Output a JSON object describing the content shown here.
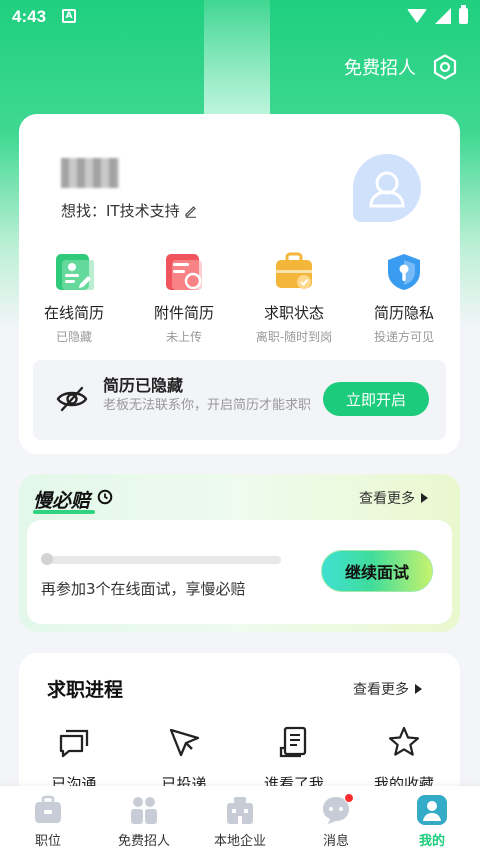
{
  "status_bar": {
    "time": "4:43",
    "notification_letter": "A"
  },
  "header": {
    "recruit_link": "免费招人"
  },
  "profile": {
    "seeking_label": "想找：IT技术支持",
    "quick_actions": [
      {
        "label": "在线简历",
        "sub": "已隐藏",
        "color": "#2fcb7a"
      },
      {
        "label": "附件简历",
        "sub": "未上传",
        "color": "#f0545c"
      },
      {
        "label": "求职状态",
        "sub": "离职-随时到岗",
        "color": "#f3b63a"
      },
      {
        "label": "简历隐私",
        "sub": "投递方可见",
        "color": "#3a9cf0"
      }
    ],
    "hidden_notice": {
      "title": "简历已隐藏",
      "desc": "老板无法联系你，开启简历才能求职",
      "button": "立即开启"
    }
  },
  "slow_card": {
    "title": "慢必赔",
    "more": "查看更多",
    "progress_fraction": 0,
    "text": "再参加3个在线面试，享慢必赔",
    "button": "继续面试"
  },
  "job_progress": {
    "title": "求职进程",
    "more": "查看更多",
    "items": [
      {
        "label": "已沟通",
        "icon": "chat-icon"
      },
      {
        "label": "已投递",
        "icon": "send-icon"
      },
      {
        "label": "谁看了我",
        "icon": "document-icon"
      },
      {
        "label": "我的收藏",
        "icon": "star-icon"
      }
    ]
  },
  "bottom_nav": {
    "items": [
      {
        "label": "职位"
      },
      {
        "label": "免费招人"
      },
      {
        "label": "本地企业"
      },
      {
        "label": "消息"
      },
      {
        "label": "我的"
      }
    ]
  },
  "colors": {
    "brand_green": "#1ccc7c",
    "badge_red": "#ff2e2e"
  }
}
